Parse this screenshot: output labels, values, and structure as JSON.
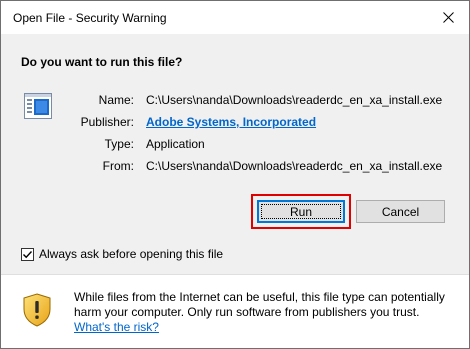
{
  "window": {
    "title": "Open File - Security Warning"
  },
  "dialog": {
    "heading": "Do you want to run this file?",
    "fields": [
      {
        "label": "Name:",
        "value": "C:\\Users\\nanda\\Downloads\\readerdc_en_xa_install.exe"
      },
      {
        "label": "Publisher:",
        "value": "Adobe Systems, Incorporated"
      },
      {
        "label": "Type:",
        "value": "Application"
      },
      {
        "label": "From:",
        "value": "C:\\Users\\nanda\\Downloads\\readerdc_en_xa_install.exe"
      }
    ],
    "run_label": "Run",
    "cancel_label": "Cancel",
    "checkbox_label": "Always ask before opening this file",
    "checkbox_checked": true
  },
  "footer": {
    "warning_text": "While files from the Internet can be useful, this file type can potentially harm your computer. Only run software from publishers you trust.",
    "link_text": "What's the risk?"
  },
  "colors": {
    "link": "#0066cc",
    "highlight": "#e00000",
    "focus_border": "#0078d7"
  },
  "icons": [
    "close-icon",
    "application-file-icon",
    "checkmark-icon",
    "security-shield-icon"
  ]
}
